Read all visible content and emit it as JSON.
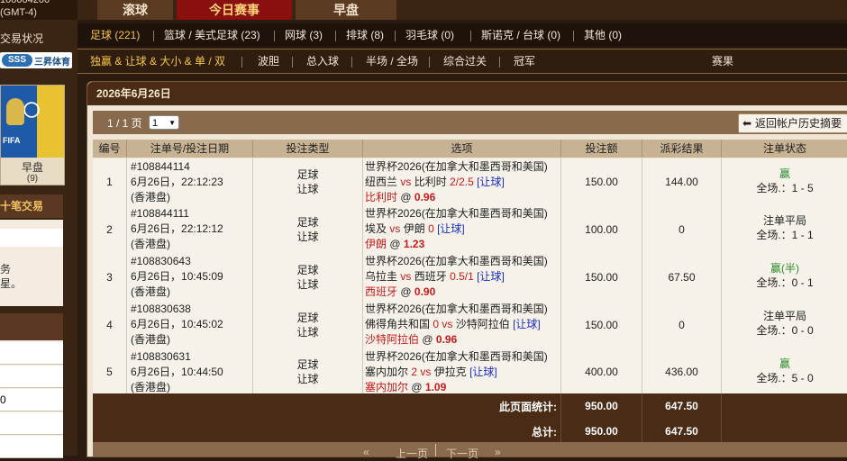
{
  "left": {
    "top_line1": "100004200",
    "top_line2": "(GMT-4)",
    "status": "交易状况",
    "brand": "三昇体育",
    "brand_logo": "SSS",
    "early_label": "早盘",
    "early_count": "(9)",
    "fifa_text": "FIFA",
    "last10": "十笔交易",
    "panel_line1": "务",
    "panel_line2": "星。",
    "list_row_text": "0"
  },
  "tabs": [
    "滚球",
    "今日赛事",
    "早盘"
  ],
  "sports": [
    {
      "label": "足球 (221)",
      "selected": true
    },
    {
      "label": "篮球 / 美式足球 (23)",
      "selected": false
    },
    {
      "label": "网球 (3)",
      "selected": false
    },
    {
      "label": "排球 (8)",
      "selected": false
    },
    {
      "label": "羽毛球 (0)",
      "selected": false
    },
    {
      "label": "斯诺克 / 台球 (0)",
      "selected": false
    },
    {
      "label": "其他 (0)",
      "selected": false
    }
  ],
  "bet_types": [
    {
      "label": "独赢 & 让球 & 大小 & 单 / 双",
      "selected": true
    },
    {
      "label": "波胆",
      "selected": false
    },
    {
      "label": "总入球",
      "selected": false
    },
    {
      "label": "半场 / 全场",
      "selected": false
    },
    {
      "label": "综合过关",
      "selected": false
    },
    {
      "label": "冠军",
      "selected": false
    },
    {
      "label": "赛果",
      "selected": false
    }
  ],
  "date_title": "2026年6月26日",
  "pager": {
    "text": "1 / 1 页",
    "selected": "1"
  },
  "return_button": "返回帐户历史摘要",
  "table": {
    "headers": [
      "编号",
      "注单号/投注日期",
      "投注类型",
      "选项",
      "投注额",
      "派彩结果",
      "注单状态"
    ],
    "rows": [
      {
        "no": "1",
        "bet_id": "#108844114",
        "bet_date": "6月26日，22:12:23",
        "market": "(香港盘)",
        "type1": "足球",
        "type2": "让球",
        "league": "世界杯2026(在加拿大和墨西哥和美国)",
        "home": "纽西兰",
        "vs": "vs",
        "away": "比利时",
        "line": "2/2.5",
        "tag": "[让球]",
        "pick": "比利时",
        "at": "@",
        "odds": "0.96",
        "stake": "150.00",
        "payout": "144.00",
        "status": "赢",
        "score": "全场.：1 - 5"
      },
      {
        "no": "2",
        "bet_id": "#108844111",
        "bet_date": "6月26日，22:12:12",
        "market": "(香港盘)",
        "type1": "足球",
        "type2": "让球",
        "league": "世界杯2026(在加拿大和墨西哥和美国)",
        "home": "埃及",
        "vs": "vs",
        "away": "伊朗",
        "line": "0",
        "tag": "[让球]",
        "pick": "伊朗",
        "at": "@",
        "odds": "1.23",
        "stake": "100.00",
        "payout": "0",
        "status": "注单平局",
        "score": "全场.：1 - 1"
      },
      {
        "no": "3",
        "bet_id": "#108830643",
        "bet_date": "6月26日，10:45:09",
        "market": "(香港盘)",
        "type1": "足球",
        "type2": "让球",
        "league": "世界杯2026(在加拿大和墨西哥和美国)",
        "home": "乌拉圭",
        "vs": "vs",
        "away": "西班牙",
        "line": "0.5/1",
        "tag": "[让球]",
        "pick": "西班牙",
        "at": "@",
        "odds": "0.90",
        "stake": "150.00",
        "payout": "67.50",
        "status": "赢(半)",
        "score": "全场.：0 - 1"
      },
      {
        "no": "4",
        "bet_id": "#108830638",
        "bet_date": "6月26日，10:45:02",
        "market": "(香港盘)",
        "type1": "足球",
        "type2": "让球",
        "league": "世界杯2026(在加拿大和墨西哥和美国)",
        "home": "佛得角共和国",
        "vs": "0 vs",
        "away": "沙特阿拉伯",
        "line": "",
        "tag": "[让球]",
        "pick": "沙特阿拉伯",
        "at": "@",
        "odds": "0.96",
        "stake": "150.00",
        "payout": "0",
        "status": "注单平局",
        "score": "全场.：0 - 0"
      },
      {
        "no": "5",
        "bet_id": "#108830631",
        "bet_date": "6月26日，10:44:50",
        "market": "(香港盘)",
        "type1": "足球",
        "type2": "让球",
        "league": "世界杯2026(在加拿大和墨西哥和美国)",
        "home": "塞内加尔",
        "vs": "2 vs",
        "away": "伊拉克",
        "line": "",
        "tag": "[让球]",
        "pick": "塞内加尔",
        "at": "@",
        "odds": "1.09",
        "stake": "400.00",
        "payout": "436.00",
        "status": "赢",
        "score": "全场.：5 - 0"
      }
    ],
    "page_total_label": "此页面统计:",
    "page_total_stake": "950.00",
    "page_total_payout": "647.50",
    "total_label": "总计:",
    "total_stake": "950.00",
    "total_payout": "647.50"
  },
  "bottom_nav": {
    "prev": "上一页",
    "next": "下一页"
  },
  "colors": {
    "accent_gold": "#f5c542",
    "win_green": "#2a8a2a",
    "odds_red": "#c81a1a",
    "tag_blue": "#1a2ec8",
    "active_tab": "#8a1010"
  }
}
